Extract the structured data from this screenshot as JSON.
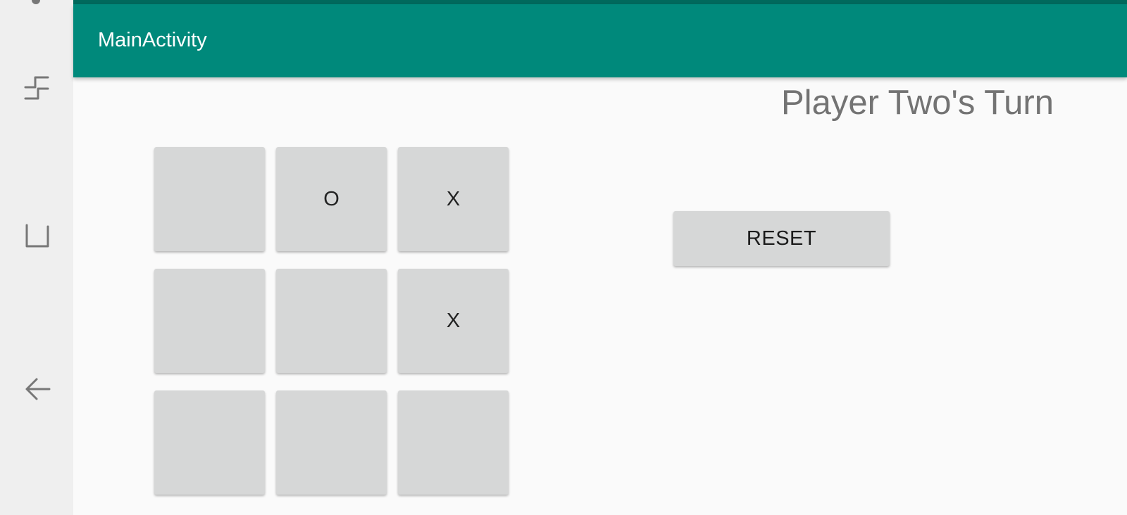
{
  "system_nav": {
    "icons": [
      "recent-apps-icon",
      "home-icon",
      "back-icon"
    ]
  },
  "toolbar": {
    "title": "MainActivity",
    "color": "#00897b",
    "status_color": "#00695c"
  },
  "game": {
    "turn_text": "Player Two's Turn",
    "board": [
      [
        "",
        "O",
        "X"
      ],
      [
        "",
        "",
        "X"
      ],
      [
        "",
        "",
        ""
      ]
    ],
    "reset_label": "RESET"
  }
}
